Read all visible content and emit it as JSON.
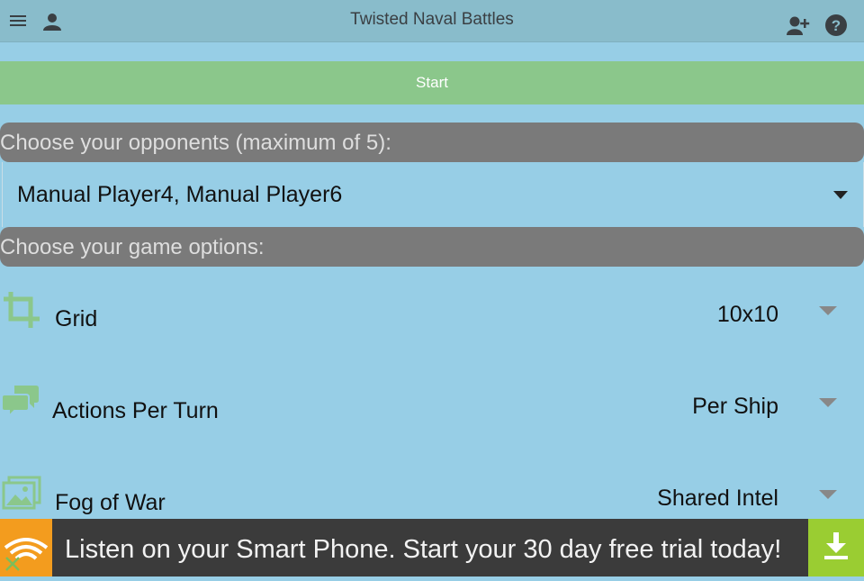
{
  "app": {
    "title": "Twisted Naval Battles",
    "icons": [
      "menu-icon",
      "user-icon",
      "add-user-icon",
      "help-icon"
    ]
  },
  "start_button": {
    "label": "Start"
  },
  "opponents": {
    "header": "Choose your opponents (maximum of 5):",
    "selected": "Manual Player4, Manual Player6"
  },
  "options": {
    "header": "Choose your game options:",
    "items": [
      {
        "icon": "crop-icon",
        "label": "Grid",
        "value": "10x10"
      },
      {
        "icon": "chat-bubbles-icon",
        "label": "Actions Per Turn",
        "value": "Per Ship"
      },
      {
        "icon": "images-icon",
        "label": "Fog of War",
        "value": "Shared Intel"
      }
    ]
  },
  "ad": {
    "text": "Listen on your Smart Phone. Start your 30 day free trial today!",
    "close_icon": "close-icon",
    "download_icon": "download-icon"
  },
  "colors": {
    "background": "#97cee6",
    "topbar": "#89bccb",
    "start": "#8bc78b",
    "section_header": "#7a7a7a",
    "icon_green": "#8bc78b",
    "ad_background": "#3b3b3b",
    "ad_logo": "#f39c1e",
    "ad_download": "#9acd32"
  }
}
